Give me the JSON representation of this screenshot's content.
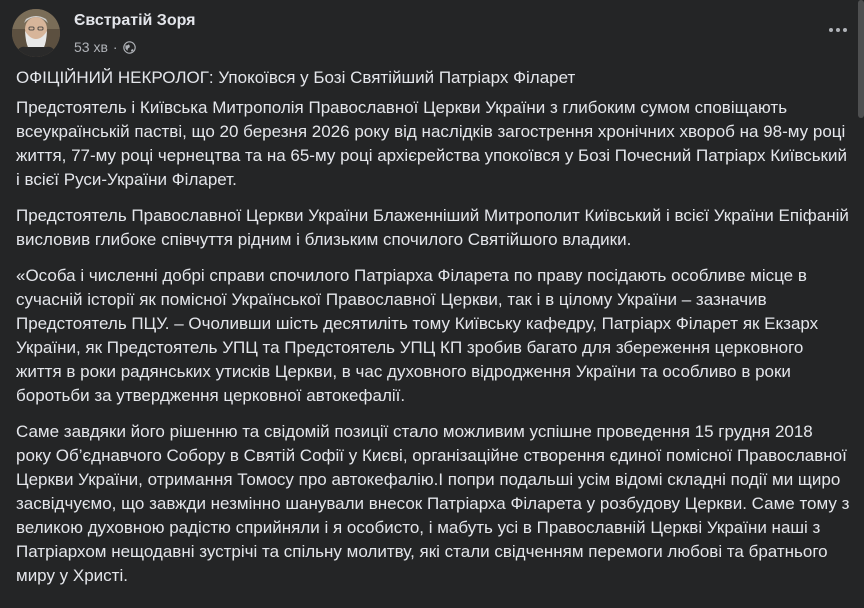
{
  "post": {
    "author": "Євстратій Зоря",
    "time": "53 хв",
    "separator": "·",
    "privacy_icon": "globe-icon",
    "menu_icon": "more-options-icon",
    "paragraphs": [
      "ОФІЦІЙНИЙ НЕКРОЛОГ: Упокоївся у Бозі Святійший Патріарх Філарет",
      "Предстоятель і Київська Митрополія Православної Церкви України з глибоким сумом сповіщають всеукраїнській пастві, що 20 березня 2026 року від наслідків загострення хронічних хвороб на 98-му році життя, 77-му році чернецтва та на 65-му році архієрейства упокоївся у Бозі Почесний Патріарх Київський і всієї Руси-України Філарет.",
      "Предстоятель Православної Церкви України Блаженніший Митрополит Київський і всієї України Епіфаній висловив глибоке співчуття рідним і близьким спочилого Святійшого владики.",
      "«Особа і численні добрі справи спочилого Патріарха Філарета по праву посідають особливе місце в сучасній історії як помісної Української Православної Церкви, так і в цілому України – зазначив Предстоятель ПЦУ. – Очоливши шість десятиліть тому Київську кафедру, Патріарх Філарет як Екзарх України, як Предстоятель УПЦ та Предстоятель УПЦ КП зробив багато для збереження церковного життя в роки радянських утисків Церкви, в час духовного відродження України та особливо в роки боротьби за утвердження церковної автокефалії.",
      "Саме завдяки його рішенню та свідомій позиції стало можливим успішне проведення 15 грудня 2018 року Об’єднавчого Собору в Святій Софії у Києві, організаційне створення єдиної помісної Православної Церкви України, отримання Томосу про автокефалію.І попри подальші усім відомі складні події ми щиро засвідчуємо, що завжди незмінно шанували внесок Патріарха Філарета у розбудову Церкви. Саме тому з великою духовною радістю сприйняли і я особисто, і мабуть усі в Православній Церкві України наші з Патріархом нещодавні зустрічі та спільну молитву, які стали свідченням перемоги любові та братнього миру у Христі."
    ]
  },
  "colors": {
    "background": "#242526",
    "text_primary": "#e4e6eb",
    "text_secondary": "#b0b3b8"
  }
}
